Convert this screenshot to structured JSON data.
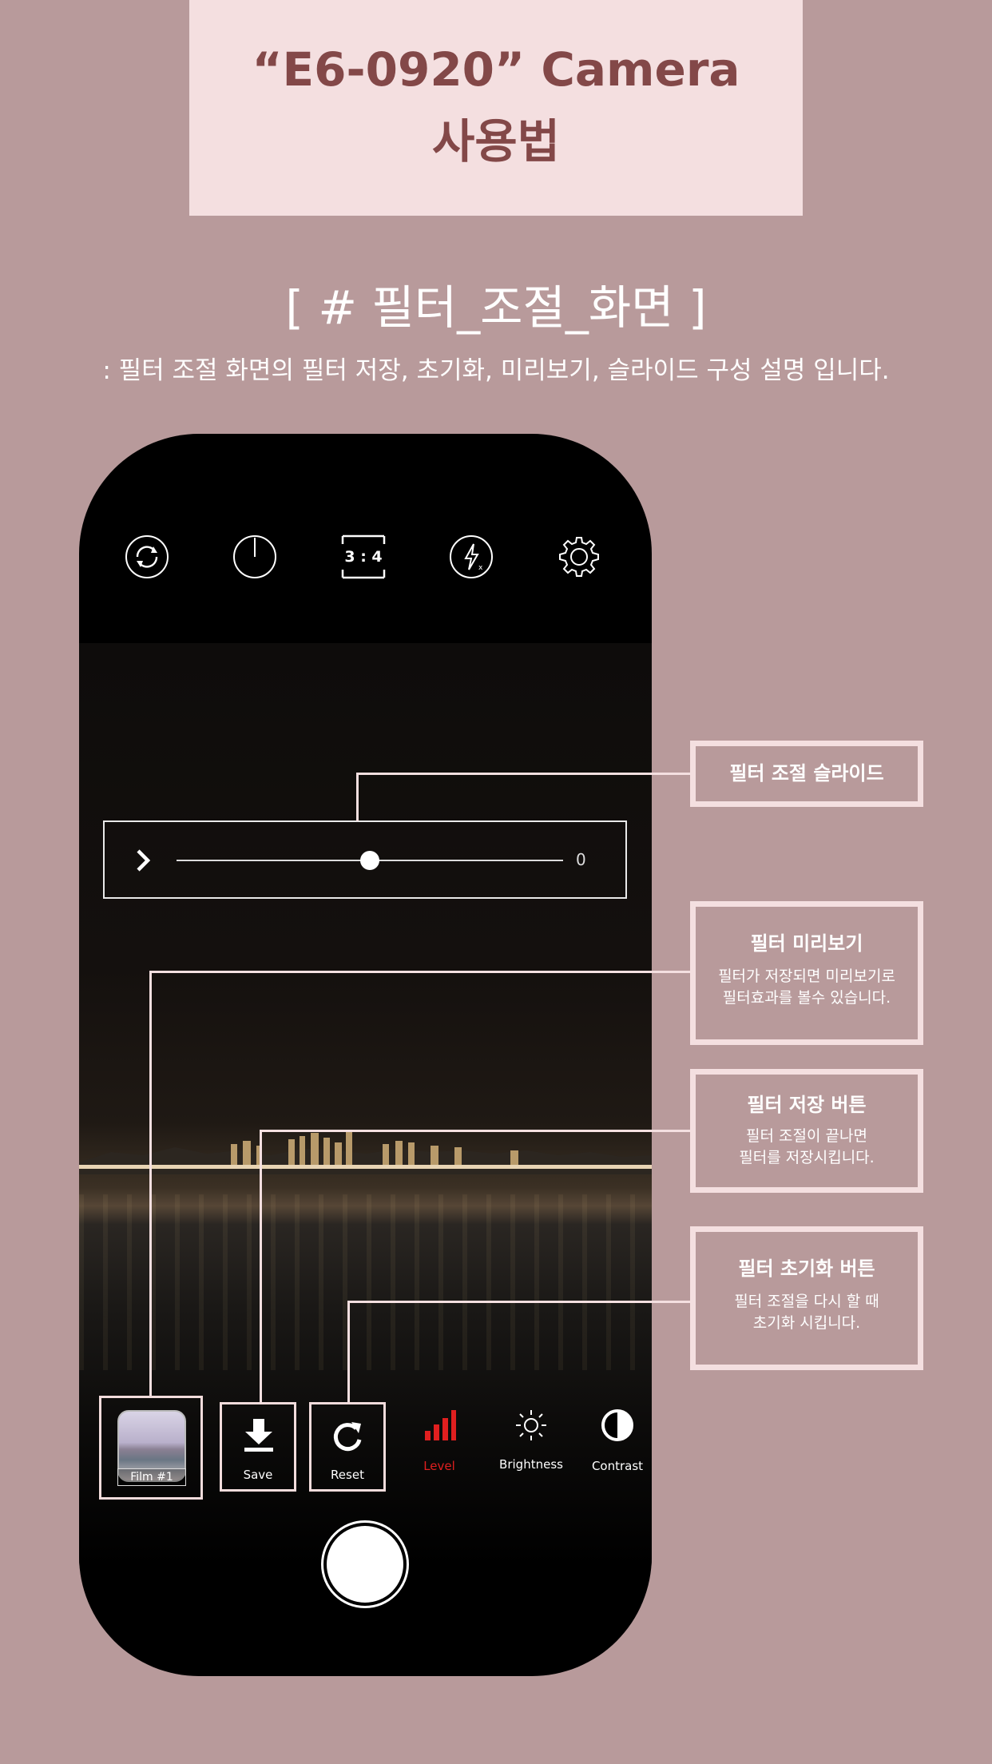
{
  "header": {
    "title_line1": "“E6-0920” Camera",
    "title_line2": "사용법"
  },
  "section": {
    "title": "[ # 필터_조절_화면 ]",
    "description": ": 필터 조절 화면의 필터 저장, 초기화, 미리보기, 슬라이드 구성 설명 입니다."
  },
  "camera": {
    "top_bar": {
      "icons": [
        "switch-camera-icon",
        "timer-icon",
        "aspect-ratio-icon",
        "flash-off-icon",
        "settings-gear-icon"
      ],
      "aspect_ratio_label": "3 : 4"
    },
    "slider": {
      "value_label": "0",
      "position_fraction": 0.5
    },
    "toolbar": {
      "film_label": "Film #1",
      "save_label": "Save",
      "reset_label": "Reset",
      "level_label": "Level",
      "brightness_label": "Brightness",
      "contrast_label": "Contrast"
    },
    "colors": {
      "level_active": "#e01f1f",
      "frame_pink": "#f4dfe0"
    }
  },
  "callouts": {
    "slider": {
      "title": "필터 조절 슬라이드"
    },
    "preview": {
      "title": "필터 미리보기",
      "desc_line1": "필터가 저장되면 미리보기로",
      "desc_line2": "필터효과를 볼수 있습니다."
    },
    "save": {
      "title": "필터 저장 버튼",
      "desc_line1": "필터 조절이 끝나면",
      "desc_line2": "필터를 저장시킵니다."
    },
    "reset": {
      "title": "필터 초기화 버튼",
      "desc_line1": "필터 조절을 다시 할 때",
      "desc_line2": "초기화 시킵니다."
    }
  },
  "theme": {
    "background": "#b89a9b",
    "title_box": "#f4dfe0",
    "title_text": "#834848"
  }
}
